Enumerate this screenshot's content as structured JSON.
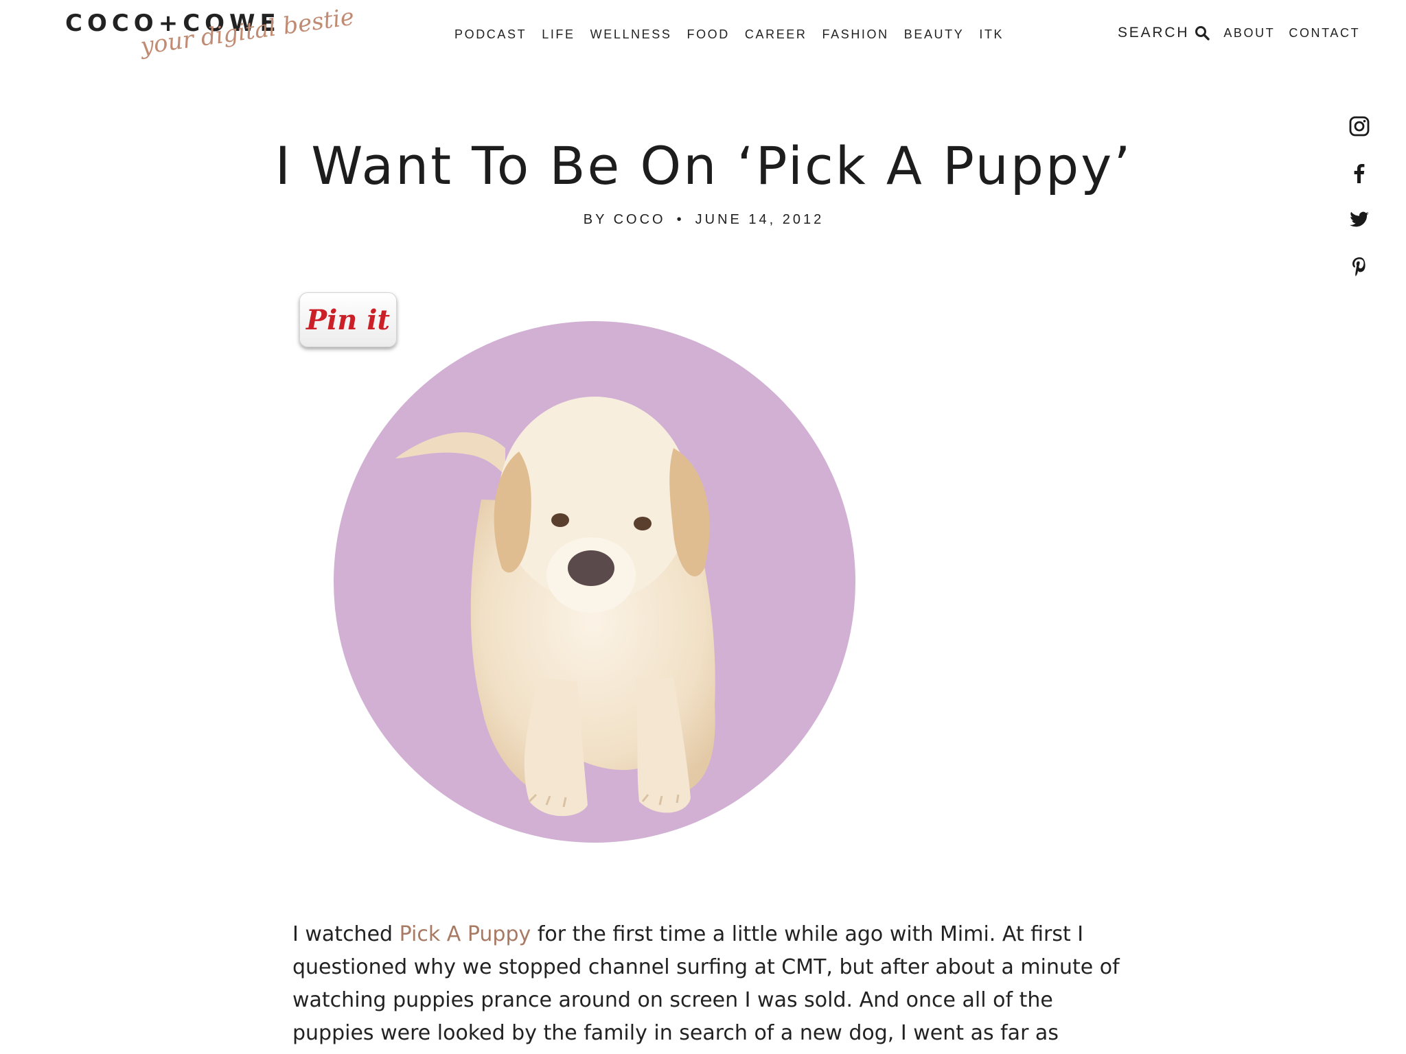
{
  "header": {
    "logo_main": "COCO+COWE",
    "logo_tagline": "your digital bestie",
    "nav": [
      {
        "label": "PODCAST"
      },
      {
        "label": "LIFE"
      },
      {
        "label": "WELLNESS"
      },
      {
        "label": "FOOD"
      },
      {
        "label": "CAREER"
      },
      {
        "label": "FASHION"
      },
      {
        "label": "BEAUTY"
      },
      {
        "label": "ITK"
      }
    ],
    "search_label": "SEARCH",
    "search_icon": "search-icon",
    "about_label": "ABOUT",
    "contact_label": "CONTACT"
  },
  "social": [
    {
      "icon": "instagram-icon"
    },
    {
      "icon": "facebook-icon"
    },
    {
      "icon": "twitter-icon"
    },
    {
      "icon": "pinterest-icon"
    }
  ],
  "article": {
    "title": "I Want To Be On ‘Pick A Puppy’",
    "byline_author": "BY COCO",
    "byline_separator": "•",
    "byline_date": "JUNE 14, 2012",
    "pin_label": "Pin it",
    "hero_image": "puppy-in-purple-circle",
    "body_intro": "I watched ",
    "body_link": "Pick A Puppy",
    "body_rest": " for the first time a little while ago with Mimi.  At first I questioned why we stopped channel surfing at CMT, but after about a minute of watching puppies prance around on screen I was sold.  And once all of the puppies were looked by the family in search of a new dog,  I went as far as"
  },
  "colors": {
    "accent_link": "#a87a63",
    "logo_script": "#c08b72",
    "hero_circle": "#d1b0d3",
    "pin_red": "#cb2027",
    "text": "#1f1f1f"
  }
}
